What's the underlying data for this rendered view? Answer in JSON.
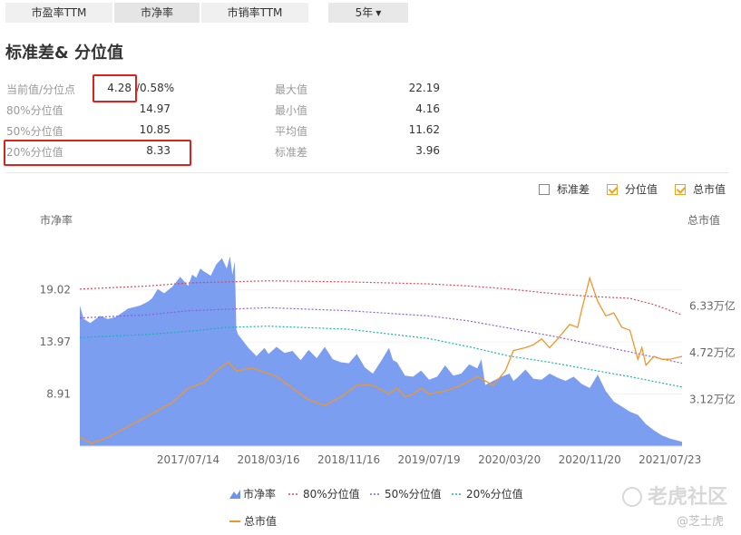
{
  "tabs": [
    {
      "label": "市盈率TTM",
      "active": false
    },
    {
      "label": "市净率",
      "active": true
    },
    {
      "label": "市销率TTM",
      "active": false
    }
  ],
  "period": {
    "label": "5年"
  },
  "section_title": "标准差& 分位值",
  "stats": {
    "current_label": "当前值/分位点",
    "current_value": "4.28",
    "current_pct": "/0.58%",
    "p80_label": "80%分位值",
    "p80_value": "14.97",
    "p50_label": "50%分位值",
    "p50_value": "10.85",
    "p20_label": "20%分位值",
    "p20_value": "8.33",
    "max_label": "最大值",
    "max_value": "22.19",
    "min_label": "最小值",
    "min_value": "4.16",
    "avg_label": "平均值",
    "avg_value": "11.62",
    "std_label": "标准差",
    "std_value": "3.96"
  },
  "toggles": [
    {
      "label": "标准差",
      "checked": false
    },
    {
      "label": "分位值",
      "checked": true
    },
    {
      "label": "总市值",
      "checked": true
    }
  ],
  "watermark": {
    "brand": "老虎社区",
    "author": "@芝士虎"
  },
  "colors": {
    "area": "#6e93ee",
    "mcap": "#f0962a",
    "p80": "#d9485a",
    "p50": "#8a60d8",
    "p20": "#16b3b0"
  },
  "chart_data": {
    "type": "area",
    "left_axis_title": "市净率",
    "right_axis_title": "总市值",
    "left_ticks": [
      "19.02",
      "13.97",
      "8.91"
    ],
    "left_tick_values": [
      19.02,
      13.97,
      8.91
    ],
    "right_ticks": [
      "6.33万亿",
      "4.72万亿",
      "3.12万亿"
    ],
    "right_tick_values": [
      6.33,
      4.72,
      3.12
    ],
    "ylim": [
      3.86,
      24.1
    ],
    "y2lim": [
      1.5,
      8.7
    ],
    "x_ticks": [
      "2017/07/14",
      "2018/03/16",
      "2018/11/16",
      "2019/07/19",
      "2020/03/20",
      "2020/11/20",
      "2021/07/23"
    ],
    "x_tick_t": [
      1.0,
      2.0,
      3.0,
      4.0,
      5.0,
      6.0,
      7.0
    ],
    "xlim": [
      -0.35,
      7.15
    ],
    "pb": {
      "name": "市净率",
      "t": [
        -0.35,
        -0.3,
        -0.22,
        -0.1,
        0.0,
        0.1,
        0.25,
        0.4,
        0.5,
        0.55,
        0.62,
        0.7,
        0.8,
        0.9,
        1.0,
        1.05,
        1.1,
        1.15,
        1.2,
        1.28,
        1.35,
        1.42,
        1.48,
        1.52,
        1.55,
        1.58,
        1.6,
        1.62,
        1.75,
        1.85,
        1.95,
        2.0,
        2.1,
        2.2,
        2.3,
        2.4,
        2.5,
        2.6,
        2.7,
        2.8,
        2.9,
        3.0,
        3.1,
        3.2,
        3.3,
        3.4,
        3.5,
        3.55,
        3.6,
        3.7,
        3.8,
        3.9,
        4.0,
        4.1,
        4.2,
        4.3,
        4.4,
        4.5,
        4.6,
        4.65,
        4.7,
        4.8,
        4.9,
        5.0,
        5.05,
        5.1,
        5.2,
        5.3,
        5.4,
        5.5,
        5.6,
        5.7,
        5.8,
        5.9,
        6.0,
        6.1,
        6.2,
        6.3,
        6.4,
        6.5,
        6.6,
        6.7,
        6.8,
        6.9,
        7.0,
        7.15
      ],
      "values": [
        17.5,
        16.2,
        15.8,
        16.5,
        16.2,
        16.4,
        17.2,
        17.5,
        17.9,
        18.2,
        19.1,
        18.7,
        19.3,
        20.3,
        19.4,
        20.5,
        20.2,
        21.1,
        20.8,
        20.4,
        21.5,
        22.1,
        21.1,
        22.3,
        20.5,
        21.8,
        15.2,
        14.7,
        13.4,
        12.6,
        13.4,
        12.8,
        13.5,
        12.9,
        13.1,
        12.2,
        13.2,
        12.4,
        13.5,
        12.3,
        12.0,
        11.9,
        12.8,
        11.5,
        10.9,
        12.1,
        13.4,
        12.2,
        12.0,
        10.7,
        10.6,
        11.2,
        10.3,
        10.6,
        11.7,
        10.7,
        10.9,
        11.8,
        11.4,
        12.3,
        9.8,
        10.2,
        10.6,
        10.9,
        10.2,
        10.5,
        11.3,
        10.4,
        10.3,
        10.9,
        10.5,
        10.2,
        10.6,
        9.9,
        9.5,
        10.8,
        9.2,
        8.2,
        7.7,
        7.2,
        6.9,
        6.0,
        5.4,
        4.9,
        4.6,
        4.28
      ]
    },
    "p80": {
      "name": "80%分位值",
      "t": [
        -0.35,
        0.5,
        1.0,
        2.0,
        3.0,
        4.0,
        4.5,
        5.0,
        5.5,
        6.0,
        6.5,
        6.8,
        7.15
      ],
      "values": [
        19.1,
        19.4,
        19.7,
        19.9,
        19.8,
        19.6,
        19.4,
        19.1,
        18.7,
        18.4,
        18.2,
        17.6,
        16.6
      ]
    },
    "p50": {
      "name": "50%分位值",
      "t": [
        -0.35,
        0.5,
        1.0,
        2.0,
        3.0,
        4.0,
        4.5,
        5.0,
        5.5,
        6.0,
        6.5,
        7.15
      ],
      "values": [
        16.3,
        16.6,
        17.0,
        17.3,
        17.0,
        16.5,
        16.0,
        15.3,
        14.6,
        13.8,
        13.0,
        11.9
      ]
    },
    "p20": {
      "name": "20%分位值",
      "t": [
        -0.35,
        0.5,
        1.0,
        1.5,
        2.0,
        3.0,
        4.0,
        4.5,
        5.0,
        5.5,
        6.0,
        6.5,
        7.15
      ],
      "values": [
        14.4,
        14.7,
        15.0,
        15.4,
        15.5,
        15.2,
        14.3,
        13.5,
        12.6,
        12.0,
        11.3,
        10.6,
        9.6
      ]
    },
    "mcap": {
      "name": "总市值",
      "t": [
        -0.35,
        -0.2,
        -0.1,
        0.0,
        0.2,
        0.4,
        0.6,
        0.8,
        1.0,
        1.1,
        1.2,
        1.35,
        1.5,
        1.6,
        1.8,
        2.0,
        2.1,
        2.3,
        2.5,
        2.7,
        2.9,
        3.0,
        3.1,
        3.3,
        3.5,
        3.6,
        3.7,
        3.8,
        3.9,
        4.0,
        4.2,
        4.4,
        4.6,
        4.8,
        4.95,
        5.05,
        5.2,
        5.3,
        5.4,
        5.5,
        5.6,
        5.75,
        5.85,
        5.9,
        6.0,
        6.1,
        6.2,
        6.3,
        6.4,
        6.5,
        6.6,
        6.65,
        6.7,
        6.8,
        6.9,
        7.0,
        7.15
      ],
      "values": [
        1.8,
        1.6,
        1.7,
        1.8,
        2.1,
        2.4,
        2.7,
        3.0,
        3.5,
        3.6,
        3.7,
        4.1,
        4.4,
        4.1,
        4.2,
        4.0,
        3.9,
        3.5,
        3.1,
        2.9,
        3.2,
        3.4,
        3.6,
        3.6,
        3.3,
        3.5,
        3.2,
        3.3,
        3.5,
        3.3,
        3.4,
        3.6,
        3.9,
        3.6,
        4.1,
        4.8,
        4.9,
        5.0,
        5.2,
        4.9,
        5.2,
        5.7,
        5.6,
        6.2,
        7.3,
        6.5,
        6.0,
        6.1,
        5.6,
        5.5,
        4.5,
        4.9,
        4.3,
        4.6,
        4.5,
        4.5,
        4.6
      ]
    }
  }
}
